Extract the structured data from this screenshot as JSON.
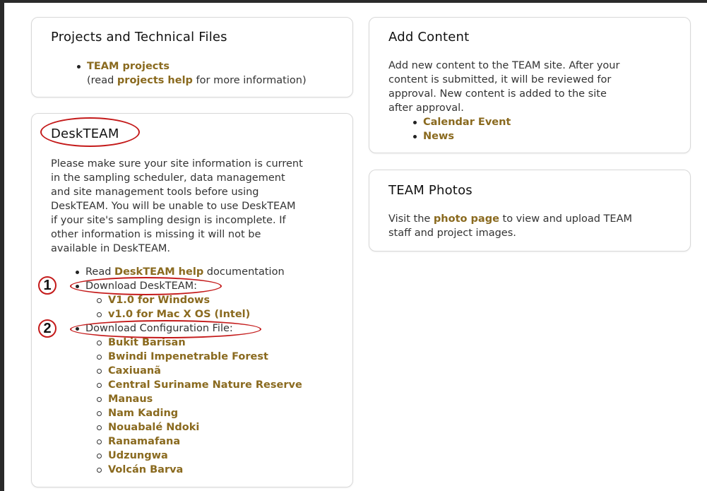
{
  "projects_panel": {
    "title": "Projects and Technical Files",
    "team_projects_link": "TEAM projects",
    "read_prefix": "(read ",
    "projects_help_link": "projects help",
    "read_suffix": " for more information)"
  },
  "desk_panel": {
    "title": "DeskTEAM",
    "intro_lines": [
      "Please make sure your site information is current",
      "in the sampling scheduler, data management",
      "and site management tools before using",
      "DeskTEAM. You will be unable to use DeskTEAM",
      "if your site's sampling design is incomplete. If",
      "other information is missing it will not be",
      "available in DeskTEAM."
    ],
    "read_prefix": "Read ",
    "help_link": "DeskTEAM help",
    "read_suffix": " documentation",
    "download_label": "Download DeskTEAM:",
    "downloads": [
      "V1.0 for Windows",
      "v1.0 for Mac X OS (Intel)"
    ],
    "config_label": "Download Configuration File:",
    "config_sites": [
      "Bukit Barisan",
      "Bwindi Impenetrable Forest",
      "Caxiuanã",
      "Central Suriname Nature Reserve",
      "Manaus",
      "Nam Kading",
      "Nouabalé Ndoki",
      "Ranamafana",
      "Udzungwa",
      "Volcán Barva"
    ],
    "markers": [
      "1",
      "2"
    ]
  },
  "add_panel": {
    "title": "Add Content",
    "intro_lines": [
      "Add new content to the TEAM site. After your",
      "content is submitted, it will be reviewed for",
      "approval. New content is added to the site",
      "after approval."
    ],
    "links": [
      "Calendar Event",
      "News"
    ]
  },
  "photos_panel": {
    "title": "TEAM Photos",
    "line1_prefix": "Visit the ",
    "photo_link": "photo page",
    "line1_suffix": " to view and upload TEAM",
    "line2": "staff and project images."
  },
  "colors": {
    "link": "#8a6a1f",
    "annotation": "#c41a1a"
  }
}
